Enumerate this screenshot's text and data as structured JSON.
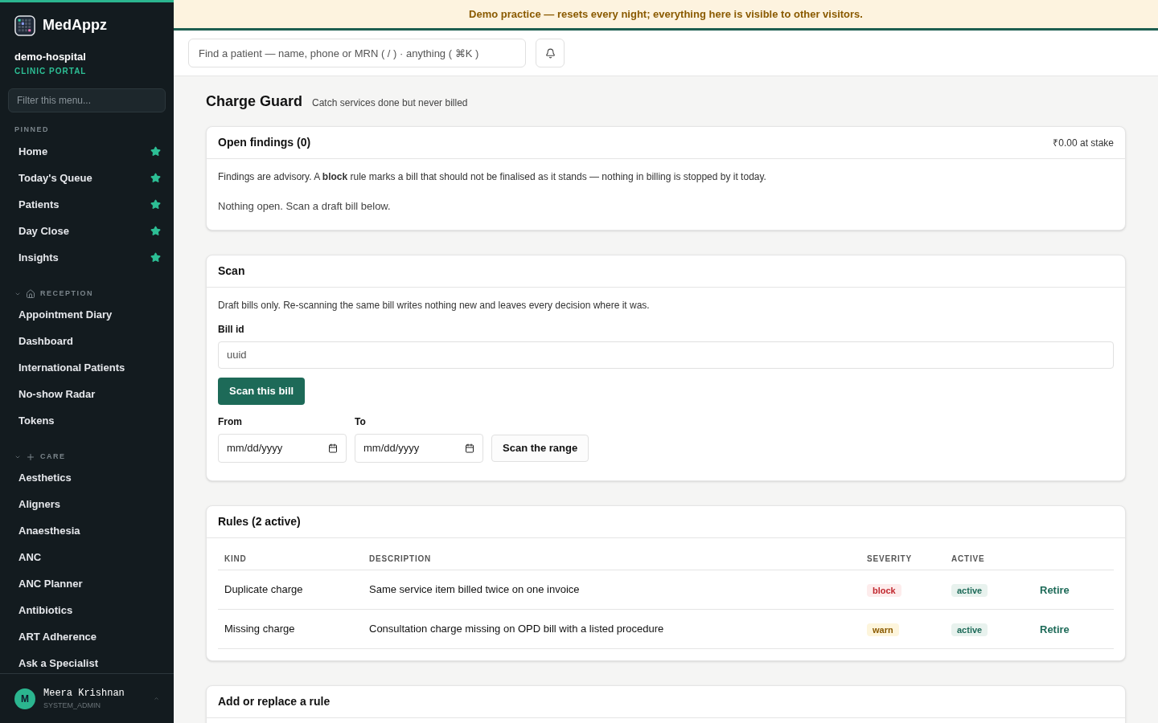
{
  "brand": {
    "name": "MedAppz",
    "org": "demo-hospital",
    "portal": "CLINIC PORTAL"
  },
  "sidebar": {
    "filter_placeholder": "Filter this menu...",
    "pinned": {
      "title": "PINNED",
      "items": [
        {
          "label": "Home",
          "starred": true
        },
        {
          "label": "Today's Queue",
          "starred": true
        },
        {
          "label": "Patients",
          "starred": true
        },
        {
          "label": "Day Close",
          "starred": true
        },
        {
          "label": "Insights",
          "starred": true
        }
      ]
    },
    "groups": [
      {
        "title": "RECEPTION",
        "kind": "home",
        "expanded": true,
        "items": [
          "Appointment Diary",
          "Dashboard",
          "International Patients",
          "No-show Radar",
          "Tokens"
        ]
      },
      {
        "title": "CARE",
        "kind": "plus",
        "expanded": true,
        "items": [
          "Aesthetics",
          "Aligners",
          "Anaesthesia",
          "ANC",
          "ANC Planner",
          "Antibiotics",
          "ART Adherence",
          "Ask a Specialist"
        ]
      }
    ],
    "user": {
      "initial": "M",
      "name": "Meera Krishnan",
      "role": "SYSTEM_ADMIN"
    }
  },
  "banner": "Demo practice — resets every night; everything here is visible to other visitors.",
  "search": {
    "placeholder": "Find a patient — name, phone or MRN ( / ) · anything ( ⌘K )"
  },
  "page": {
    "title": "Charge Guard",
    "subtitle": "Catch services done but never billed"
  },
  "findings": {
    "title": "Open findings (0)",
    "at_stake": "₹0.00 at stake",
    "note": "Findings are advisory. A **block** rule marks a bill that should not be finalised as it stands — nothing in billing is stopped by it today.",
    "empty": "Nothing open. Scan a draft bill below."
  },
  "scan": {
    "title": "Scan",
    "note": "Draft bills only. Re-scanning the same bill writes nothing new and leaves every decision where it was.",
    "bill_label": "Bill id",
    "bill_placeholder": "uuid",
    "scan_button": "Scan this bill",
    "from_label": "From",
    "to_label": "To",
    "from_placeholder": "mm/dd/yyyy",
    "to_placeholder": "mm/dd/yyyy",
    "range_button": "Scan the range"
  },
  "rules": {
    "title": "Rules (2 active)",
    "columns": [
      "KIND",
      "DESCRIPTION",
      "SEVERITY",
      "ACTIVE"
    ],
    "rows": [
      {
        "kind_label": "Duplicate charge",
        "description": "Same service item billed twice on one invoice",
        "severity": {
          "label": "block",
          "kind": "danger"
        },
        "active": "active",
        "action": "Retire"
      },
      {
        "kind_label": "Missing charge",
        "description": "Consultation charge missing on OPD bill with a listed procedure",
        "severity": {
          "label": "warn",
          "kind": "warning"
        },
        "active": "active",
        "action": "Retire"
      }
    ]
  },
  "add_rule": {
    "title": "Add or replace a rule"
  }
}
